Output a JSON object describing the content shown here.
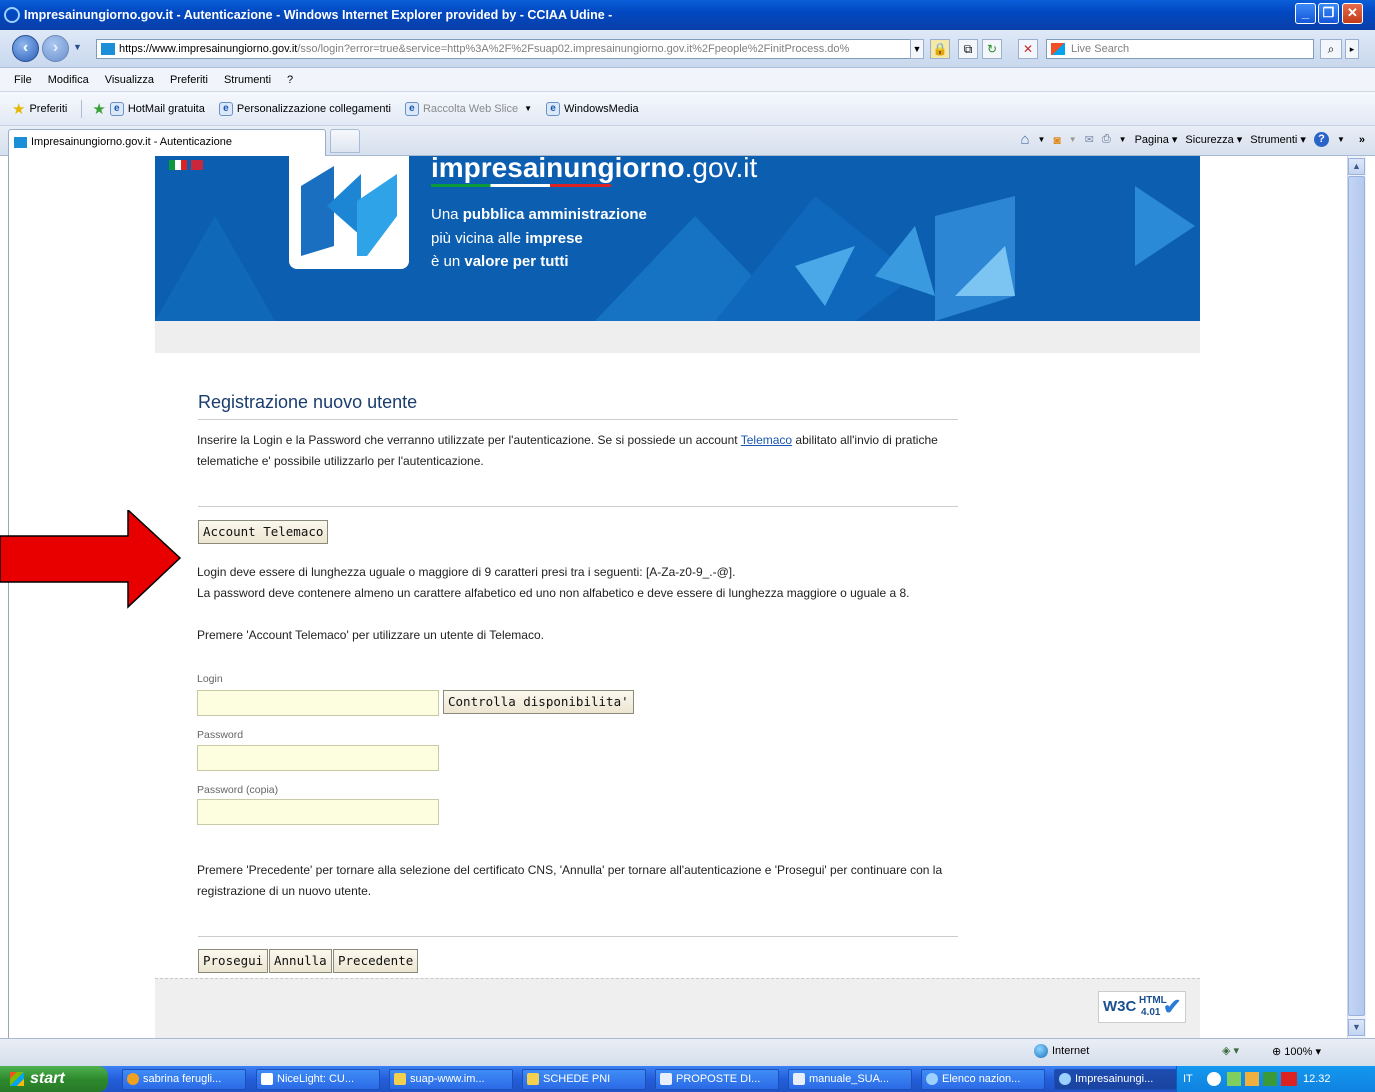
{
  "window": {
    "title": "Impresainungiorno.gov.it - Autenticazione - Windows Internet Explorer provided by  - CCIAA Udine -"
  },
  "address": {
    "url_prefix": "https://",
    "url_domain": "www.impresainungiorno.gov.it",
    "url_rest": "/sso/login?error=true&service=http%3A%2F%2Fsuap02.impresainungiorno.gov.it%2Fpeople%2FinitProcess.do%",
    "search_placeholder": "Live Search"
  },
  "menu": [
    "File",
    "Modifica",
    "Visualizza",
    "Preferiti",
    "Strumenti",
    "?"
  ],
  "favorites": {
    "label": "Preferiti",
    "items": [
      "HotMail gratuita",
      "Personalizzazione collegamenti",
      "Raccolta Web Slice",
      "WindowsMedia"
    ]
  },
  "tab": {
    "title": "Impresainungiorno.gov.it - Autenticazione"
  },
  "command_bar": {
    "page": "Pagina",
    "security": "Sicurezza",
    "tools": "Strumenti"
  },
  "banner": {
    "site_name_bold": "impresa",
    "site_name_mid": "inungiorno",
    "site_name_tld": ".gov.it",
    "line1_plain": "Una ",
    "line1_bold": "pubblica amministrazione",
    "line2_plain": "più vicina alle ",
    "line2_bold": "imprese",
    "line3_plain": "è un ",
    "line3_bold": "valore per tutti"
  },
  "page": {
    "title": "Registrazione nuovo utente",
    "intro_before_link": "Inserire la Login e la Password che verranno utilizzate per l'autenticazione. Se si possiede un account ",
    "intro_link": "Telemaco",
    "intro_after_link": " abilitato all'invio di pratiche telematiche e' possibile utilizzarlo per l'autenticazione.",
    "account_button": "Account Telemaco",
    "rules": [
      "Login deve essere di lunghezza uguale o maggiore di 9 caratteri presi tra i seguenti: [A-Za-z0-9_.-@].",
      "La password deve contenere almeno un carattere alfabetico ed uno non alfabetico e deve essere di lunghezza maggiore o uguale a 8.",
      "Premere 'Account Telemaco' per utilizzare un utente di Telemaco."
    ],
    "login_label": "Login",
    "login_value": "",
    "check_button": "Controlla disponibilita'",
    "password_label": "Password",
    "password_value": "",
    "password_copy_label": "Password (copia)",
    "password_copy_value": "",
    "outro": "Premere 'Precedente' per tornare alla selezione del certificato CNS, 'Annulla' per tornare all'autenticazione e 'Prosegui' per continuare con la registrazione di un nuovo utente.",
    "btn_next": "Prosegui",
    "btn_cancel": "Annulla",
    "btn_prev": "Precedente"
  },
  "w3c": {
    "w3c": "W3C",
    "html": "HTML",
    "version": "4.01"
  },
  "status": {
    "zone": "Internet",
    "zoom": "100%"
  },
  "taskbar": {
    "start": "start",
    "items": [
      "sabrina ferugli...",
      "NiceLight: CU...",
      "suap-www.im...",
      "SCHEDE PNI",
      "PROPOSTE DI...",
      "manuale_SUA...",
      "Elenco nazion...",
      "Impresainungi..."
    ],
    "lang": "IT",
    "clock": "12.32"
  },
  "colors": {
    "banner_blue": "#0c5fb0",
    "arrow_red": "#e80000",
    "section_title": "#1a3d6e",
    "input_bg": "#fdfde0"
  }
}
